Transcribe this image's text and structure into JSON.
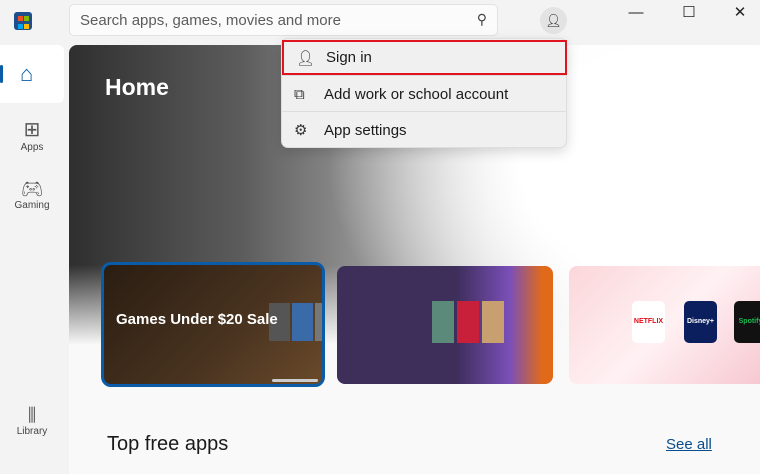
{
  "search": {
    "placeholder": "Search apps, games, movies and more"
  },
  "window": {
    "minimize": "—",
    "maximize": "☐",
    "close": "✕"
  },
  "sidebar": {
    "items": [
      {
        "label": "Home"
      },
      {
        "label": "Apps"
      },
      {
        "label": "Gaming"
      },
      {
        "label": "Library"
      }
    ]
  },
  "hero": {
    "title": "Home"
  },
  "cards": [
    {
      "title": "Games Under $20 Sale"
    },
    {
      "title": ""
    },
    {
      "tiles": [
        "NETFLIX",
        "Disney+",
        "Spotify"
      ]
    }
  ],
  "section": {
    "title": "Top free apps",
    "see_all": "See all"
  },
  "account_menu": {
    "items": [
      {
        "label": "Sign in"
      },
      {
        "label": "Add work or school account"
      },
      {
        "label": "App settings"
      }
    ]
  },
  "colors": {
    "accent": "#0a5ca8",
    "highlight": "#e0141e"
  }
}
